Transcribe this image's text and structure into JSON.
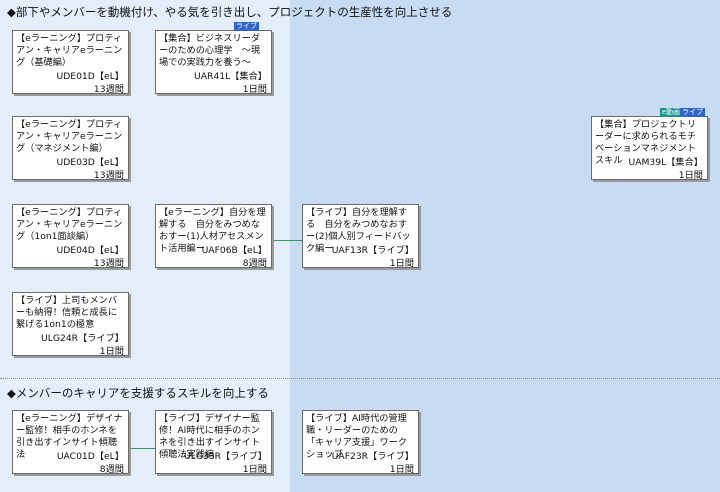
{
  "sections": [
    {
      "title": "◆部下やメンバーを動機付け、やる気を引き出し、プロジェクトの生産性を向上させる"
    },
    {
      "title": "◆メンバーのキャリアを支援するスキルを向上する"
    }
  ],
  "courses": [
    {
      "title": "【eラーニング】プロティアン・キャリアeラーニング（基礎編）",
      "code": "UDE01D【eL】",
      "duration": "13週間"
    },
    {
      "title": "【集合】ビジネスリーダーのための心理学　～現場での実践力を養う～",
      "code": "UAR41L【集合】",
      "duration": "1日間",
      "badges": [
        "ライブ"
      ]
    },
    {
      "title": "【eラーニング】プロティアン・キャリアeラーニング（マネジメント編）",
      "code": "UDE03D【eL】",
      "duration": "13週間"
    },
    {
      "title": "【eラーニング】プロティアン・キャリアeラーニング（1on1面談編）",
      "code": "UDE04D【eL】",
      "duration": "13週間"
    },
    {
      "title": "【eラーニング】自分を理解する　自分をみつめなおすー(1)人材アセスメント活用編ー",
      "code": "UAF06B【eL】",
      "duration": "8週間"
    },
    {
      "title": "【ライブ】自分を理解する　自分をみつめなおすー(2)個人別フィードバック編ー",
      "code": "UAF13R【ライブ】",
      "duration": "1日間"
    },
    {
      "title": "【ライブ】上司もメンバーも納得！信頼と成長に繋げる1on1の極意",
      "code": "ULG24R【ライブ】",
      "duration": "1日間"
    },
    {
      "title": "【集合】プロジェクトリーダーに求められるモチベーションマネジメントスキル",
      "code": "UAM39L【集合】",
      "duration": "1日間",
      "badges": [
        "e動画",
        "ライブ"
      ]
    },
    {
      "title": "【eラーニング】デザイナー監修！相手のホンネを引き出すインサイト傾聴法",
      "code": "UAC01D【eL】",
      "duration": "8週間"
    },
    {
      "title": "【ライブ】デザイナー監修！AI時代に相手のホンネを引き出すインサイト傾聴法実践編",
      "code": "ULG33R【ライブ】",
      "duration": "1日間"
    },
    {
      "title": "【ライブ】AI時代の管理職・リーダーのための「キャリア支援」ワークショップ",
      "code": "UAF23R【ライブ】",
      "duration": "1日間"
    }
  ]
}
